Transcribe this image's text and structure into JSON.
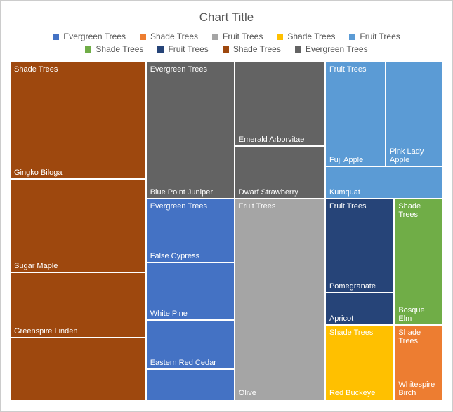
{
  "chart_data": {
    "type": "treemap",
    "title": "Chart Title",
    "legend": [
      {
        "label": "Evergreen Trees",
        "color": "#4472C4"
      },
      {
        "label": "Shade Trees",
        "color": "#ED7D31"
      },
      {
        "label": "Fruit Trees",
        "color": "#A5A5A5"
      },
      {
        "label": "Shade Trees",
        "color": "#FFC000"
      },
      {
        "label": "Fruit Trees",
        "color": "#5B9BD5"
      },
      {
        "label": "Shade Trees",
        "color": "#70AD47"
      },
      {
        "label": "Fruit Trees",
        "color": "#264478"
      },
      {
        "label": "Shade Trees",
        "color": "#9E480E"
      },
      {
        "label": "Evergreen Trees",
        "color": "#636363"
      }
    ],
    "cells": [
      {
        "category": "Shade Trees",
        "name": "Gingko Biloga",
        "color": "#9E480E",
        "x": 0,
        "y": 0,
        "w": 31.5,
        "h": 34.8
      },
      {
        "category": "",
        "name": "Sugar Maple",
        "color": "#9E480E",
        "x": 0,
        "y": 34.8,
        "w": 31.5,
        "h": 27.5
      },
      {
        "category": "",
        "name": "Greenspire Linden",
        "color": "#9E480E",
        "x": 0,
        "y": 62.3,
        "w": 31.5,
        "h": 19.4
      },
      {
        "category": "",
        "name": "",
        "color": "#9E480E",
        "x": 0,
        "y": 81.7,
        "w": 31.5,
        "h": 18.3,
        "nolabel": true
      },
      {
        "category": "Evergreen Trees",
        "name": "Blue Point Juniper",
        "color": "#636363",
        "x": 31.5,
        "y": 0,
        "w": 20.5,
        "h": 40.5
      },
      {
        "category": "",
        "name": "Emerald Arborvitae",
        "color": "#636363",
        "x": 52,
        "y": 0,
        "w": 21,
        "h": 25,
        "namealign": "bottom"
      },
      {
        "category": "",
        "name": "Dwarf Strawberry",
        "color": "#636363",
        "x": 52,
        "y": 25,
        "w": 21,
        "h": 15.5
      },
      {
        "category": "Fruit Trees",
        "name": "Fuji Apple",
        "color": "#5B9BD5",
        "x": 73,
        "y": 0,
        "w": 14,
        "h": 31
      },
      {
        "category": "",
        "name": "Pink Lady Apple",
        "color": "#5B9BD5",
        "x": 87,
        "y": 0,
        "w": 13,
        "h": 31
      },
      {
        "category": "",
        "name": "Kumquat",
        "color": "#5B9BD5",
        "x": 73,
        "y": 31,
        "w": 27,
        "h": 9.5
      },
      {
        "category": "Evergreen Trees",
        "name": "False Cypress",
        "color": "#4472C4",
        "x": 31.5,
        "y": 40.5,
        "w": 20.5,
        "h": 19
      },
      {
        "category": "",
        "name": "White Pine",
        "color": "#4472C4",
        "x": 31.5,
        "y": 59.5,
        "w": 20.5,
        "h": 17
      },
      {
        "category": "",
        "name": "Eastern Red Cedar",
        "color": "#4472C4",
        "x": 31.5,
        "y": 76.5,
        "w": 20.5,
        "h": 14.5
      },
      {
        "category": "",
        "name": "",
        "color": "#4472C4",
        "x": 31.5,
        "y": 91,
        "w": 20.5,
        "h": 9,
        "nolabel": true
      },
      {
        "category": "Fruit Trees",
        "name": "Olive",
        "color": "#A5A5A5",
        "x": 52,
        "y": 40.5,
        "w": 21,
        "h": 59.5
      },
      {
        "category": "Fruit Trees",
        "name": "Pomegranate",
        "color": "#264478",
        "x": 73,
        "y": 40.5,
        "w": 16,
        "h": 28
      },
      {
        "category": "",
        "name": "Apricot",
        "color": "#264478",
        "x": 73,
        "y": 68.5,
        "w": 16,
        "h": 9.5
      },
      {
        "category": "Shade Trees",
        "name": "Bosque Elm",
        "color": "#70AD47",
        "x": 89,
        "y": 40.5,
        "w": 11,
        "h": 37.5
      },
      {
        "category": "Shade Trees",
        "name": "Red Buckeye",
        "color": "#FFC000",
        "x": 73,
        "y": 78,
        "w": 16,
        "h": 22
      },
      {
        "category": "Shade Trees",
        "name": "Whitespire Birch",
        "color": "#ED7D31",
        "x": 89,
        "y": 78,
        "w": 11,
        "h": 22
      }
    ]
  }
}
